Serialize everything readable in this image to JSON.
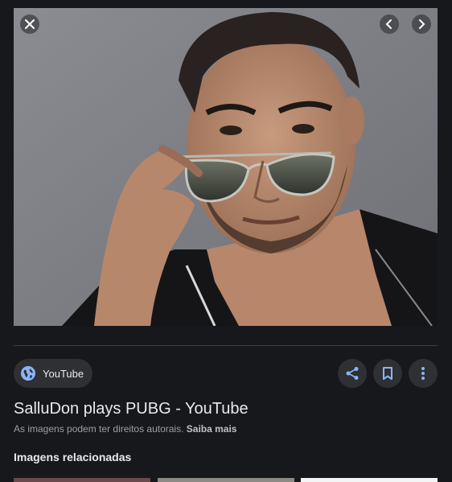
{
  "image": {
    "alt": "SalluDon plays PUBG - YouTube"
  },
  "nav": {
    "close_icon": "close-icon",
    "prev_icon": "chevron-left-icon",
    "next_icon": "chevron-right-icon"
  },
  "source": {
    "name": "YouTube",
    "icon": "globe-icon",
    "icon_color": "#8ab4f8"
  },
  "actions": {
    "share_icon": "share-icon",
    "save_icon": "bookmark-icon",
    "more_icon": "more-vert-icon",
    "icon_color": "#8ab4f8"
  },
  "result": {
    "title": "SalluDon plays PUBG - YouTube",
    "copyright_text": "As imagens podem ter direitos autorais.",
    "learn_more": "Saiba mais"
  },
  "related": {
    "heading": "Imagens relacionadas"
  }
}
